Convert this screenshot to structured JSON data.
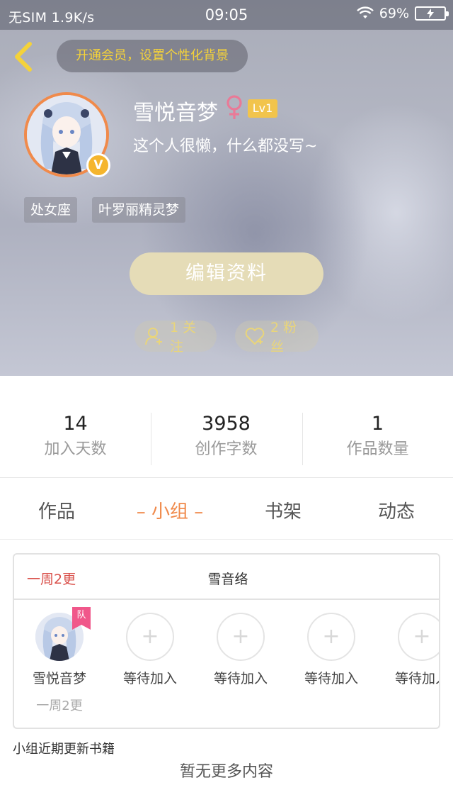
{
  "status_bar": {
    "carrier": "无SIM 1.9K/s",
    "time": "09:05",
    "battery": "69%"
  },
  "header": {
    "vip_prompt": "开通会员，设置个性化背景",
    "username": "雪悦音梦",
    "level": "Lv1",
    "bio": "这个人很懒，什么都没写~",
    "tags": [
      "处女座",
      "叶罗丽精灵梦"
    ],
    "verified_badge": "V",
    "edit_button": "编辑资料",
    "follow": "1 关注",
    "fans": "2 粉丝"
  },
  "stats": [
    {
      "value": "14",
      "label": "加入天数"
    },
    {
      "value": "3958",
      "label": "创作字数"
    },
    {
      "value": "1",
      "label": "作品数量"
    }
  ],
  "tabs": [
    {
      "label": "作品"
    },
    {
      "label": "– 小组 –"
    },
    {
      "label": "书架"
    },
    {
      "label": "动态"
    }
  ],
  "active_tab": "小组",
  "group": {
    "frequency": "一周2更",
    "name": "雪音络",
    "team_badge": "队",
    "members": [
      {
        "name": "雪悦音梦",
        "sub": "一周2更"
      },
      {
        "name": "等待加入"
      },
      {
        "name": "等待加入"
      },
      {
        "name": "等待加入"
      },
      {
        "name": "等待加入"
      }
    ]
  },
  "recent_books_label": "小组近期更新书籍",
  "empty_text": "暂无更多内容",
  "colors": {
    "accent": "#f0894a",
    "vip_text": "#f4d23a",
    "freq_red": "#d9504a",
    "edit_button": "#e5dcb7"
  },
  "icons": [
    "back-arrow-icon",
    "wifi-icon",
    "battery-icon",
    "female-icon",
    "verified-icon",
    "follow-user-icon",
    "heart-icon",
    "plus-icon"
  ]
}
